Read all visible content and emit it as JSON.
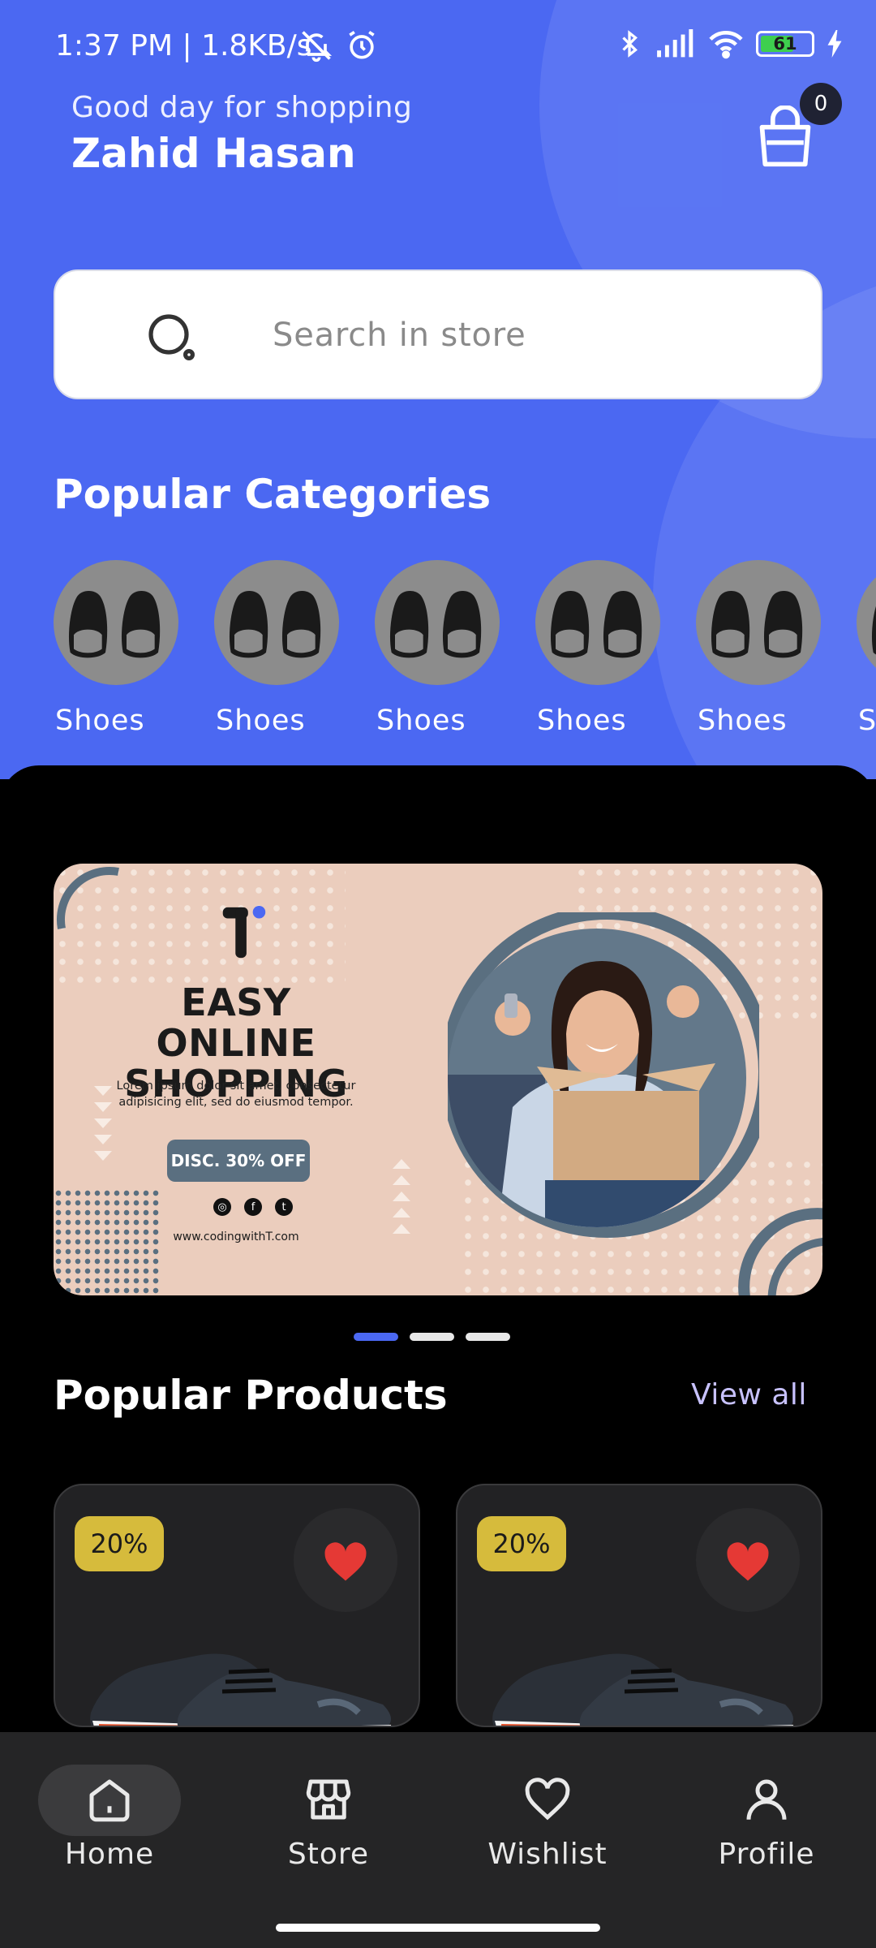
{
  "status_bar": {
    "time_speed": "1:37 PM | 1.8KB/s",
    "battery_level": "61",
    "battery_color": "#3ecf4e"
  },
  "header": {
    "greeting": "Good day for shopping",
    "user_name": "Zahid Hasan",
    "cart_count": "0",
    "background_color": "#4b68f2"
  },
  "search": {
    "placeholder": "Search in store"
  },
  "categories": {
    "title": "Popular Categories",
    "items": [
      {
        "label": "Shoes",
        "icon": "shoes-icon"
      },
      {
        "label": "Shoes",
        "icon": "shoes-icon"
      },
      {
        "label": "Shoes",
        "icon": "shoes-icon"
      },
      {
        "label": "Shoes",
        "icon": "shoes-icon"
      },
      {
        "label": "Shoes",
        "icon": "shoes-icon"
      },
      {
        "label": "Shoes",
        "icon": "shoes-icon"
      }
    ]
  },
  "banner": {
    "title_line1": "EASY ONLINE",
    "title_line2": "SHOPPING",
    "description": "Lorem ipsum dolor sit amet, consectetur adipisicing elit, sed do eiusmod tempor.",
    "button_label": "DISC. 30% OFF",
    "url": "www.codingwithT.com",
    "pages": 3,
    "active_page": 1
  },
  "products": {
    "title": "Popular Products",
    "view_all_label": "View all",
    "items": [
      {
        "discount": "20%",
        "favorited": true
      },
      {
        "discount": "20%",
        "favorited": true
      }
    ]
  },
  "bottom_nav": {
    "items": [
      {
        "label": "Home",
        "icon": "home-icon",
        "active": true
      },
      {
        "label": "Store",
        "icon": "store-icon",
        "active": false
      },
      {
        "label": "Wishlist",
        "icon": "heart-icon",
        "active": false
      },
      {
        "label": "Profile",
        "icon": "user-icon",
        "active": false
      }
    ]
  }
}
